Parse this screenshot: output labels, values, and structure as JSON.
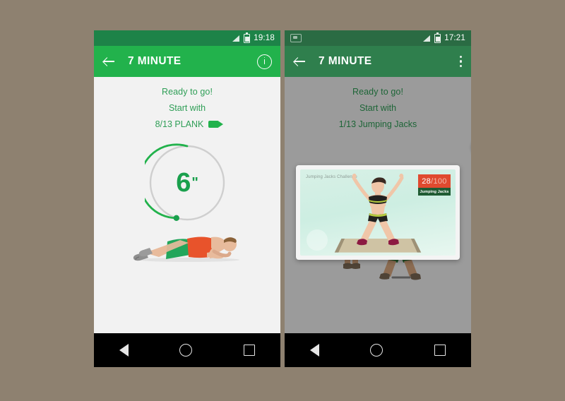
{
  "background_color": "#8e8170",
  "accent_color": "#22b24c",
  "phones": [
    {
      "id": "left",
      "status_bar": {
        "time": "19:18",
        "icons": [
          "signal-icon",
          "battery-icon"
        ],
        "background": "#1d8348"
      },
      "toolbar": {
        "back_label": "back-arrow",
        "title": "7 MINUTE",
        "action_label": "info",
        "background": "#22b24c"
      },
      "content": {
        "ready_text": "Ready to go!",
        "start_text": "Start with",
        "exercise_text": "8/13 PLANK",
        "has_video_icon": true,
        "timer": {
          "value": "6",
          "unit": "\"",
          "progress_percent": 70,
          "ring_color": "#22b24c",
          "track_color": "#cfcfcf"
        },
        "illustration": "plank-exercise-figure"
      },
      "nav_bar": {
        "back": "back-triangle",
        "home": "home-circle",
        "recents": "recents-square"
      }
    },
    {
      "id": "right",
      "dimmed": true,
      "status_bar": {
        "time": "17:21",
        "icons": [
          "sim-icon",
          "signal-icon",
          "battery-icon"
        ],
        "background": "#2a6b43"
      },
      "toolbar": {
        "back_label": "back-arrow",
        "title": "7 MINUTE",
        "action_label": "more-options",
        "background": "#2f7f4d"
      },
      "content": {
        "ready_text": "Ready to go!",
        "start_text": "Start with",
        "exercise_text": "1/13 Jumping Jacks",
        "highlight_badge": {
          "icon": "video-camera-icon",
          "color": "#22b24c"
        },
        "video_card": {
          "title": "Jumping Jacks Challenge",
          "counter_current": "28",
          "counter_total": "/100",
          "counter_label": "Jumping Jacks",
          "counter_bg": "#e04a2f",
          "label_bg": "#1f5b33"
        },
        "illustration": "jumping-jacks-figures"
      },
      "nav_bar": {
        "back": "back-triangle",
        "home": "home-circle",
        "recents": "recents-square"
      }
    }
  ]
}
